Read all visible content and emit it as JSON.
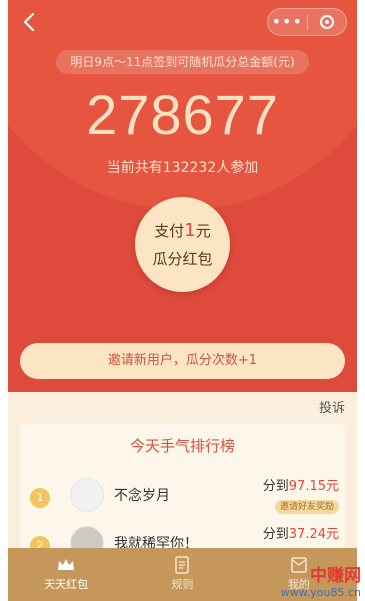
{
  "nav": {
    "back": "<"
  },
  "header": {
    "notice": "明日9点～11点签到可随机瓜分总金额(元)",
    "amount": "278677",
    "participants": "当前共有132232人参加"
  },
  "pay": {
    "prefix": "支付",
    "amount": "1",
    "suffix": "元",
    "line2": "瓜分红包"
  },
  "invite": {
    "label": "邀请新用户，瓜分次数+1"
  },
  "report": {
    "label": "投诉"
  },
  "ranking": {
    "title": "今天手气排行榜",
    "rows": [
      {
        "rank": "1",
        "name": "不念岁月",
        "share_prefix": "分到",
        "share_amount": "97.15元",
        "badge": "邀请好友奖励"
      },
      {
        "rank": "2",
        "name": "我就稀罕你！",
        "share_prefix": "分到",
        "share_amount": "37.24元"
      }
    ]
  },
  "tabs": [
    {
      "label": "天天红包",
      "icon": "crown-icon",
      "active": true
    },
    {
      "label": "规则",
      "icon": "document-icon"
    },
    {
      "label": "我的",
      "icon": "mail-icon"
    }
  ],
  "watermark": {
    "title": "中赚网",
    "url": "www.you85.cn"
  },
  "colors": {
    "hero": "#de4a3c",
    "cream": "#fbe5c4",
    "tabbar": "#c5975b",
    "accent": "#e24a38"
  }
}
